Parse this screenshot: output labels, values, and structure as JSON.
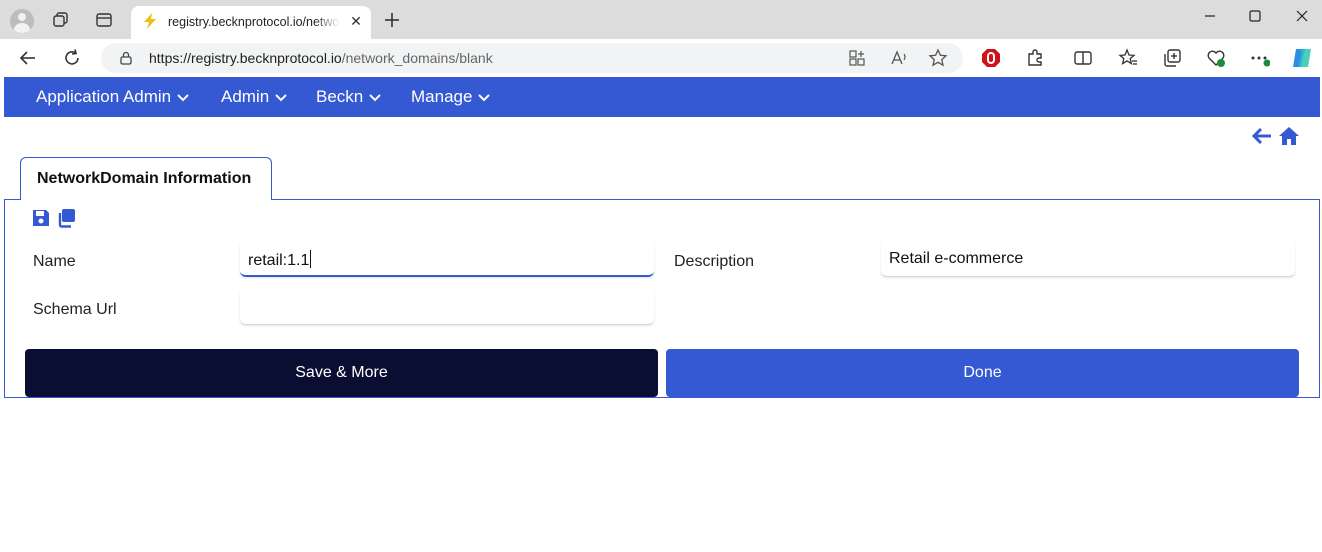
{
  "browser": {
    "tab_title": "registry.becknprotocol.io/network_domains/blank",
    "url_host": "https://registry.becknprotocol.io",
    "url_path": "/network_domains/blank",
    "tab_close_glyph": "✕"
  },
  "nav": {
    "items": [
      {
        "label": "Application Admin"
      },
      {
        "label": "Admin"
      },
      {
        "label": "Beckn"
      },
      {
        "label": "Manage"
      }
    ]
  },
  "form": {
    "tab_label": "NetworkDomain Information",
    "name_label": "Name",
    "name_value": "retail:1.1",
    "description_label": "Description",
    "description_value": "Retail e-commerce",
    "schema_url_label": "Schema Url",
    "schema_url_value": ""
  },
  "buttons": {
    "save_more": "Save & More",
    "done": "Done"
  },
  "colors": {
    "accent": "#3558d3",
    "dark_button": "#0b0e33"
  },
  "icons": [
    "back-icon",
    "refresh-icon",
    "lock-icon",
    "save-icon",
    "copy-icon",
    "arrow-left-icon",
    "home-icon"
  ]
}
